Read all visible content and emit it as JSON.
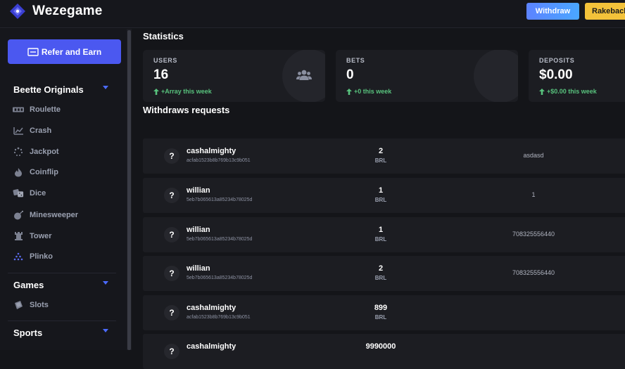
{
  "header": {
    "brand": "Wezegame",
    "withdraw_label": "Withdraw",
    "rakeback_label": "Rakeback"
  },
  "sidebar": {
    "refer_label": "Refer and Earn",
    "originals": {
      "title": "Beette Originals",
      "items": [
        {
          "label": "Roulette",
          "icon": "roulette-icon"
        },
        {
          "label": "Crash",
          "icon": "chart-icon"
        },
        {
          "label": "Jackpot",
          "icon": "spinner-icon"
        },
        {
          "label": "Coinflip",
          "icon": "fire-icon"
        },
        {
          "label": "Dice",
          "icon": "dice-icon"
        },
        {
          "label": "Minesweeper",
          "icon": "bomb-icon"
        },
        {
          "label": "Tower",
          "icon": "tower-icon"
        },
        {
          "label": "Plinko",
          "icon": "plinko-icon"
        }
      ]
    },
    "games": {
      "title": "Games",
      "items": [
        {
          "label": "Slots",
          "icon": "slots-icon"
        }
      ]
    },
    "sports": {
      "title": "Sports"
    }
  },
  "statistics": {
    "title": "Statistics",
    "cards": [
      {
        "label": "USERS",
        "value": "16",
        "delta": "+Array this week"
      },
      {
        "label": "BETS",
        "value": "0",
        "delta": "+0 this week"
      },
      {
        "label": "DEPOSITS",
        "value": "$0.00",
        "delta": "+$0.00 this week"
      }
    ]
  },
  "withdraws": {
    "title": "Withdraws requests",
    "rows": [
      {
        "name": "cashalmighty",
        "hash": "acfab1523b8b769b13c9b051",
        "amount": "2",
        "currency": "BRL",
        "pix": "asdasd"
      },
      {
        "name": "willian",
        "hash": "5eb7b065613a85234b78025d",
        "amount": "1",
        "currency": "BRL",
        "pix": "1"
      },
      {
        "name": "willian",
        "hash": "5eb7b065613a85234b78025d",
        "amount": "1",
        "currency": "BRL",
        "pix": "708325556440"
      },
      {
        "name": "willian",
        "hash": "5eb7b065613a85234b78025d",
        "amount": "2",
        "currency": "BRL",
        "pix": "708325556440"
      },
      {
        "name": "cashalmighty",
        "hash": "acfab1523b8b769b13c9b051",
        "amount": "899",
        "currency": "BRL",
        "pix": ""
      },
      {
        "name": "cashalmighty",
        "hash": "",
        "amount": "9990000",
        "currency": "",
        "pix": ""
      }
    ]
  },
  "colors": {
    "accent": "#4b58f0",
    "positive": "#58c27d",
    "rakeback": "#f3c23a"
  }
}
